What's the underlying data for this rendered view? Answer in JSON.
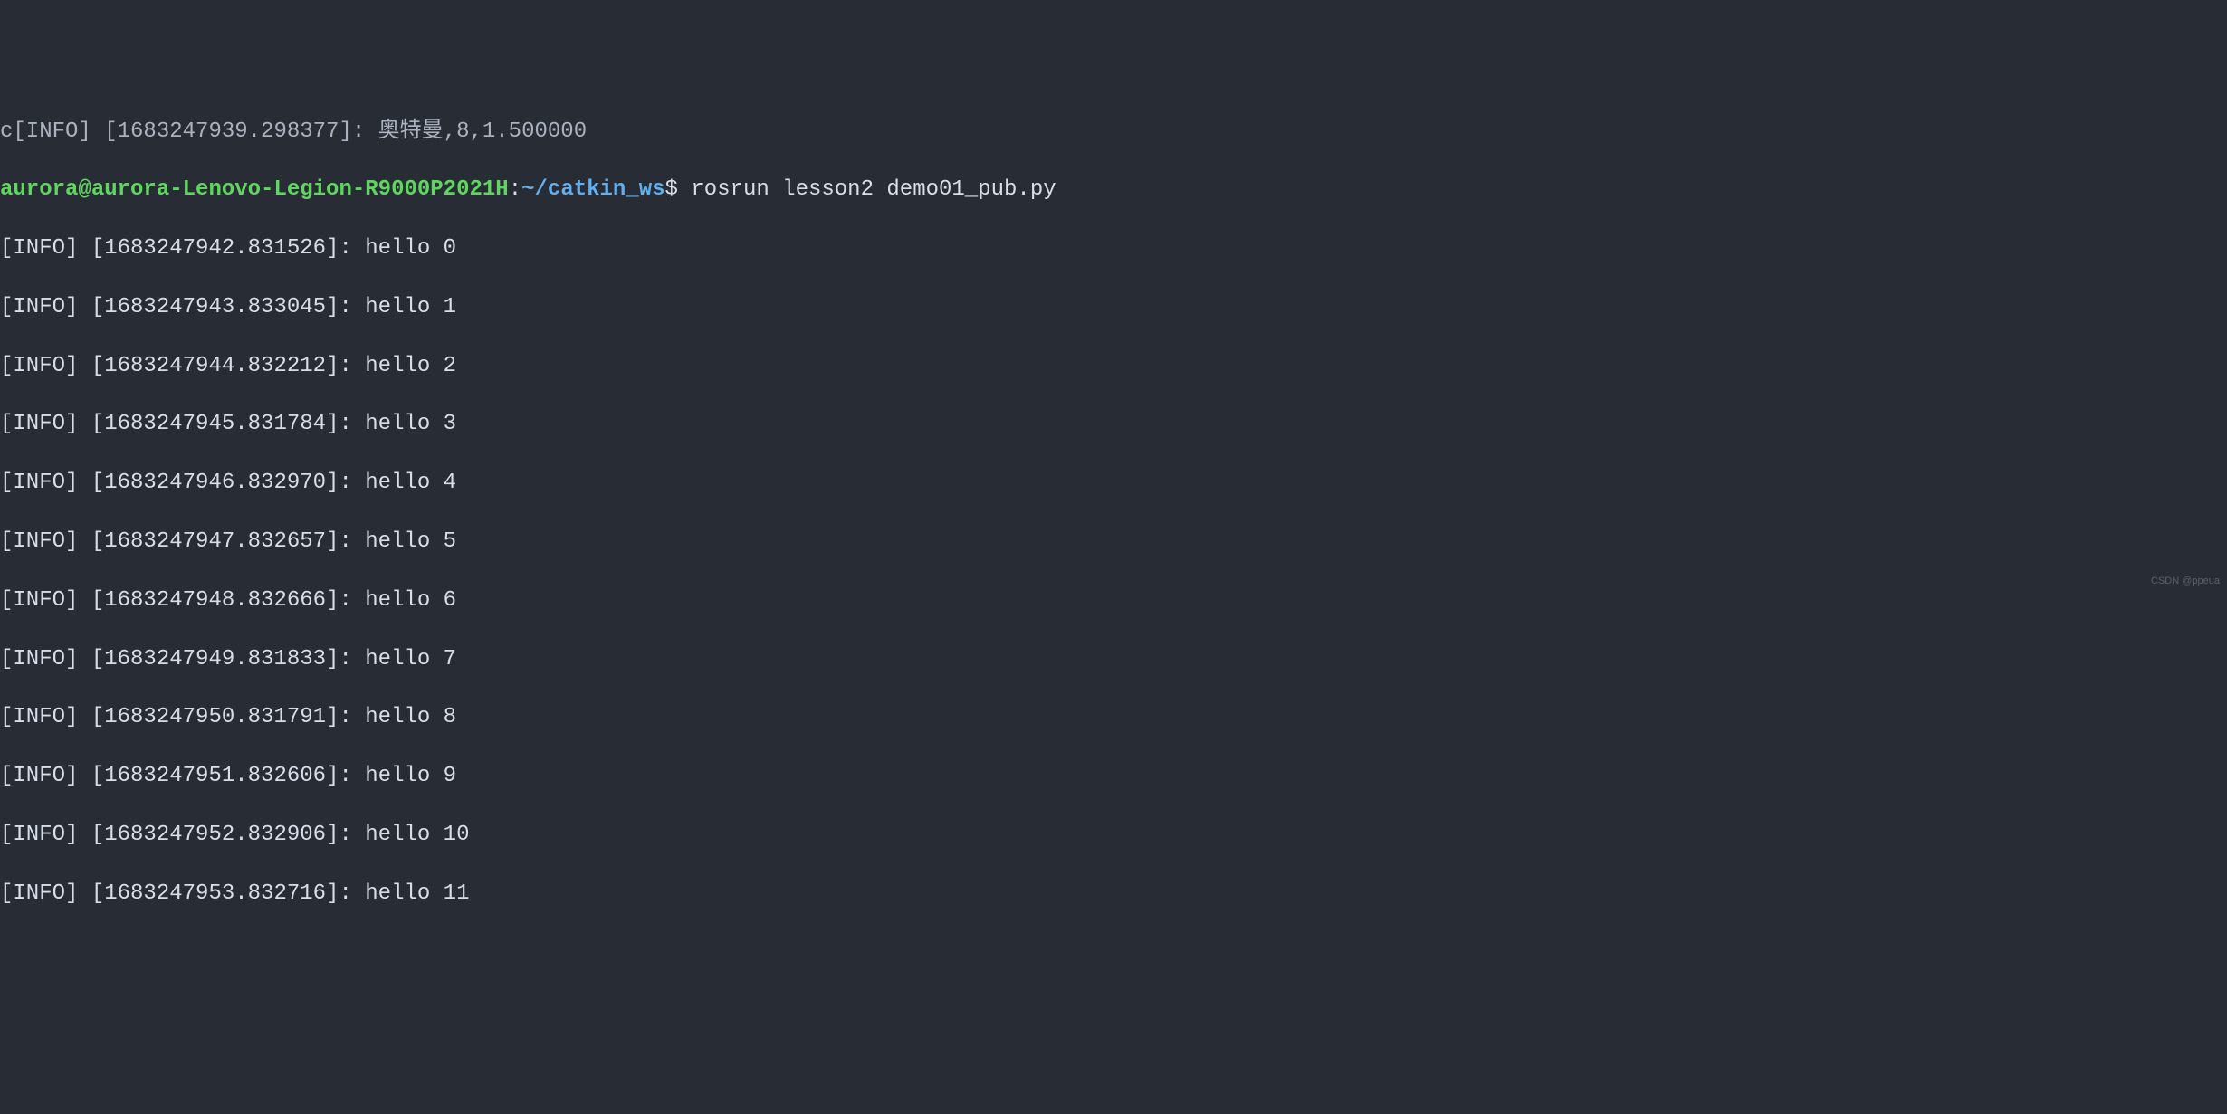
{
  "partial_top_line": "c[INFO] [1683247939.298377]: 奥特曼,8,1.500000",
  "prompt": {
    "user_host": "aurora@aurora-Lenovo-Legion-R9000P2021H",
    "colon": ":",
    "path": "~/catkin_ws",
    "dollar": "$",
    "command": " rosrun lesson2 demo01_pub.py"
  },
  "log_lines": [
    "[INFO] [1683247942.831526]: hello 0",
    "[INFO] [1683247943.833045]: hello 1",
    "[INFO] [1683247944.832212]: hello 2",
    "[INFO] [1683247945.831784]: hello 3",
    "[INFO] [1683247946.832970]: hello 4",
    "[INFO] [1683247947.832657]: hello 5",
    "[INFO] [1683247948.832666]: hello 6",
    "[INFO] [1683247949.831833]: hello 7",
    "[INFO] [1683247950.831791]: hello 8",
    "[INFO] [1683247951.832606]: hello 9",
    "[INFO] [1683247952.832906]: hello 10",
    "[INFO] [1683247953.832716]: hello 11"
  ],
  "watermark": "CSDN @ppeua"
}
